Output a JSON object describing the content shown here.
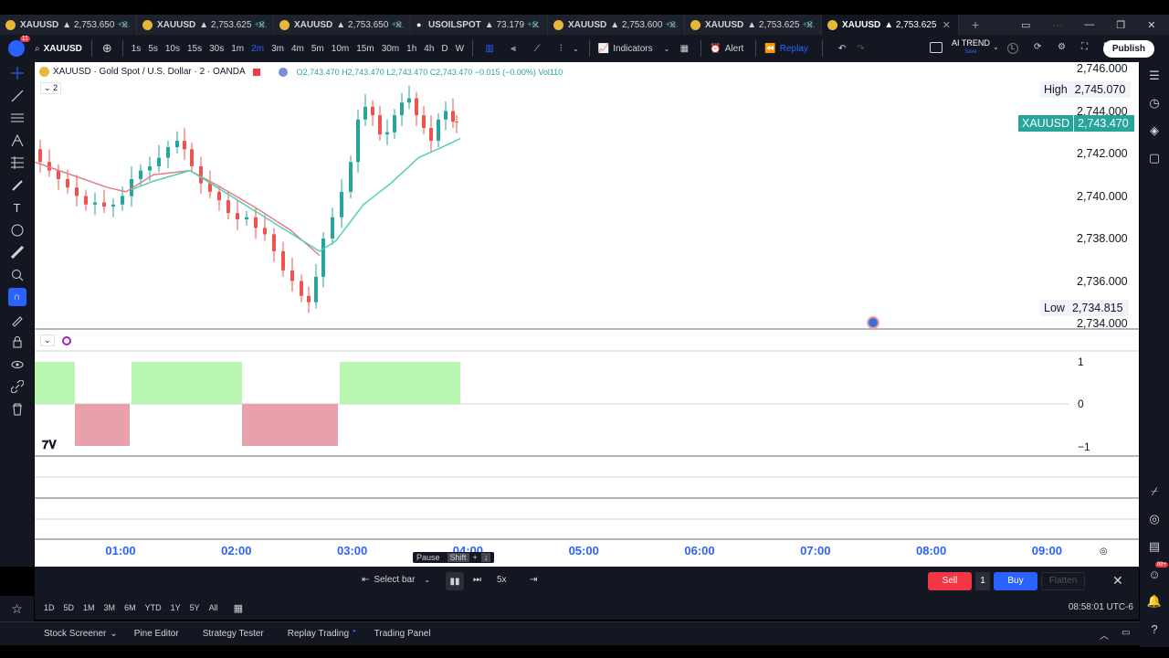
{
  "tabs": [
    {
      "symbol": "XAUUSD",
      "price": "▲ 2,753.650",
      "chg": "+0.",
      "icon": "coin-icon"
    },
    {
      "symbol": "XAUUSD",
      "price": "▲ 2,753.625",
      "chg": "+0.",
      "icon": "coin-icon"
    },
    {
      "symbol": "XAUUSD",
      "price": "▲ 2,753.650",
      "chg": "+0.",
      "icon": "coin-icon"
    },
    {
      "symbol": "USOILSPOT",
      "price": "▲ 73.179",
      "chg": "+0.",
      "icon": "drop-icon"
    },
    {
      "symbol": "XAUUSD",
      "price": "▲ 2,753.600",
      "chg": "+0.",
      "icon": "coin-icon"
    },
    {
      "symbol": "XAUUSD",
      "price": "▲ 2,753.625",
      "chg": "+0.",
      "icon": "coin-icon"
    },
    {
      "symbol": "XAUUSD",
      "price": "▲ 2,753.625",
      "chg": "",
      "icon": "coin-icon"
    }
  ],
  "toolbar": {
    "notif_count": "11",
    "symbol": "XAUUSD",
    "intervals": [
      "1s",
      "5s",
      "10s",
      "15s",
      "30s",
      "1m",
      "2m",
      "3m",
      "4m",
      "5m",
      "10m",
      "15m",
      "30m",
      "1h",
      "4h",
      "D",
      "W"
    ],
    "active_interval": "2m",
    "indicators": "Indicators",
    "alert": "Alert",
    "replay": "Replay",
    "layout_name": "AI TREND",
    "layout_sub": "Save",
    "layout_key": "L",
    "publish": "Publish"
  },
  "chart": {
    "legend_title": "XAUUSD · Gold Spot / U.S. Dollar · 2 · OANDA",
    "legend_ohlc": "O2,743.470  H2,743.470  L2,743.470  C2,743.470  −0.015 (−0.00%)  Vol110",
    "indicator_count": "2",
    "price_labels": [
      "2,746.000",
      "2,744.000",
      "2,742.000",
      "2,740.000",
      "2,738.000",
      "2,736.000",
      "2,734.000"
    ],
    "high_label": "High",
    "high_value": "2,745.070",
    "low_label": "Low",
    "low_value": "2,734.815",
    "current_symbol": "XAUUSD",
    "current_value": "2,743.470",
    "osc_labels": [
      "1",
      "0",
      "−1"
    ],
    "time_labels": [
      "01:00",
      "02:00",
      "03:00",
      "04:00",
      "05:00",
      "06:00",
      "07:00",
      "08:00",
      "09:00"
    ],
    "colors": {
      "up": "#26a69a",
      "down": "#ef5350",
      "ma1": "#e57c8a",
      "ma2": "#4dd4a8",
      "osc_up": "#b8f5b0",
      "osc_down": "#e8a0ab"
    }
  },
  "replay": {
    "select_bar": "Select bar",
    "pause": "Pause",
    "shortcut": "Shift",
    "shortcut_plus": "+",
    "shortcut_key": "↓",
    "speed": "5x",
    "sell": "Sell",
    "qty": "1",
    "buy": "Buy",
    "flatten": "Flatten"
  },
  "ranges": [
    "1D",
    "5D",
    "1M",
    "3M",
    "6M",
    "YTD",
    "1Y",
    "5Y",
    "All"
  ],
  "clock": "08:58:01 UTC-6",
  "panels": [
    "Stock Screener",
    "Pine Editor",
    "Strategy Tester",
    "Replay Trading",
    "Trading Panel"
  ],
  "notif_badge": "99+"
}
